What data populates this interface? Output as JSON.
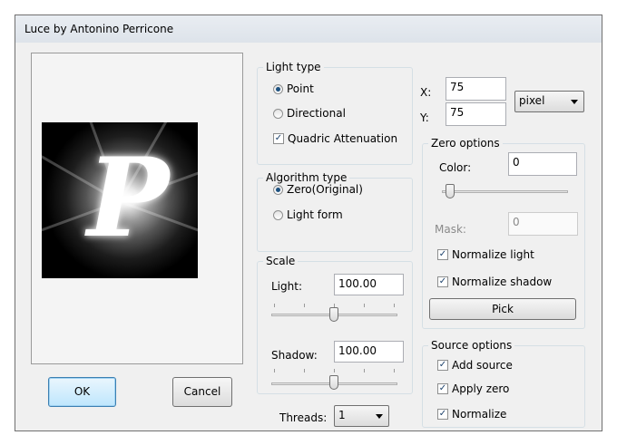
{
  "window": {
    "title": "Luce by Antonino Perricone"
  },
  "buttons": {
    "ok": "OK",
    "cancel": "Cancel",
    "pick": "Pick"
  },
  "light_type": {
    "legend": "Light type",
    "point": "Point",
    "directional": "Directional",
    "selected": "Point",
    "quadric": "Quadric Attenuation",
    "quadric_checked": true
  },
  "algorithm_type": {
    "legend": "Algorithm type",
    "zero": "Zero(Original)",
    "light_form": "Light form",
    "selected": "Zero(Original)"
  },
  "scale": {
    "legend": "Scale",
    "light_label": "Light:",
    "light_value": "100.00",
    "shadow_label": "Shadow:",
    "shadow_value": "100.00"
  },
  "threads": {
    "label": "Threads:",
    "value": "1"
  },
  "position": {
    "x_label": "X:",
    "x_value": "75",
    "y_label": "Y:",
    "y_value": "75",
    "unit": "pixel"
  },
  "zero_options": {
    "legend": "Zero options",
    "color_label": "Color:",
    "color_value": "0",
    "mask_label": "Mask:",
    "mask_value": "0",
    "normalize_light": "Normalize light",
    "normalize_light_checked": true,
    "normalize_shadow": "Normalize shadow",
    "normalize_shadow_checked": true
  },
  "source_options": {
    "legend": "Source options",
    "add_source": "Add source",
    "apply_zero": "Apply zero",
    "normalize": "Normalize",
    "add_source_checked": true,
    "apply_zero_checked": true,
    "normalize_checked": true
  },
  "preview": {
    "glyph": "P"
  },
  "icons": {
    "check": "check-icon",
    "dropdown": "chevron-down-icon"
  }
}
